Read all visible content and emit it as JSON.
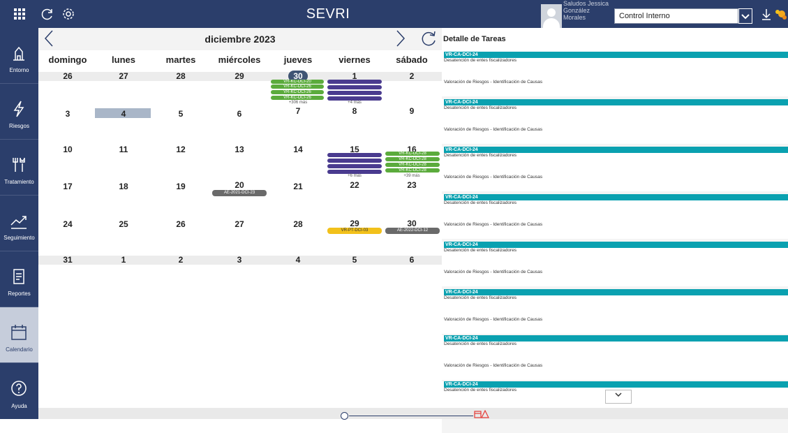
{
  "app": {
    "title": "SEVRI"
  },
  "user": {
    "greeting": "Saludos Jessica González Morales"
  },
  "selector": {
    "value": "Control Interno"
  },
  "sidebar": {
    "items": [
      {
        "label": "Entorno",
        "icon": "building-icon"
      },
      {
        "label": "Riesgos",
        "icon": "lightning-icon"
      },
      {
        "label": "Tratamiento",
        "icon": "tools-icon"
      },
      {
        "label": "Seguimiento",
        "icon": "trend-chart-icon"
      },
      {
        "label": "Reportes",
        "icon": "report-icon"
      },
      {
        "label": "Calendario",
        "icon": "calendar-icon"
      },
      {
        "label": "Ayuda",
        "icon": "help-icon"
      }
    ]
  },
  "calendar": {
    "month_label": "diciembre 2023",
    "weekdays": [
      "domingo",
      "lunes",
      "martes",
      "miércoles",
      "jueves",
      "viernes",
      "sábado"
    ],
    "weeks": [
      [
        "26",
        "27",
        "28",
        "29",
        "30",
        "1",
        "2"
      ],
      [
        "3",
        "4",
        "5",
        "6",
        "7",
        "8",
        "9"
      ],
      [
        "10",
        "11",
        "12",
        "13",
        "14",
        "15",
        "16"
      ],
      [
        "17",
        "18",
        "19",
        "20",
        "21",
        "22",
        "23"
      ],
      [
        "24",
        "25",
        "26",
        "27",
        "28",
        "29",
        "30"
      ],
      [
        "31",
        "1",
        "2",
        "3",
        "4",
        "5",
        "6"
      ]
    ],
    "events": {
      "thu30_pills": [
        "VR-KC-DCI-20",
        "VR-KC-DCI-26",
        "VR-KC-DCI-26",
        "VR-KC-DCI-26"
      ],
      "thu30_more": "+306 más",
      "fri1_more": "+4 más",
      "fri15_more": "+6 más",
      "sat16_pills": [
        "VR-KC-DCI-28",
        "VR-KC-DCI-28",
        "VR-KC-DCI-28",
        "VR-KC-DCI-28"
      ],
      "sat16_more": "+39 más",
      "wed20_pill": "AE-2021-DCI-23",
      "fri29_pill": "VR-PT-DCI-03",
      "sat30_pill": "AE-2022-DCI-12"
    }
  },
  "detail": {
    "title": "Detalle de Tareas",
    "tasks": [
      {
        "code": "VR-CA-DCI-24",
        "subtitle": "Desatención de entes fiscalizadores",
        "activity": "Valoración de Riesgos - Identificación de Causas"
      },
      {
        "code": "VR-CA-DCI-24",
        "subtitle": "Desatención de entes fiscalizadores",
        "activity": "Valoración de Riesgos - Identificación de Causas"
      },
      {
        "code": "VR-CA-DCI-24",
        "subtitle": "Desatención de entes fiscalizadores",
        "activity": "Valoración de Riesgos - Identificación de Causas"
      },
      {
        "code": "VR-CA-DCI-24",
        "subtitle": "Desatención de entes fiscalizadores",
        "activity": "Valoración de Riesgos - Identificación de Causas"
      },
      {
        "code": "VR-CA-DCI-24",
        "subtitle": "Desatención de entes fiscalizadores",
        "activity": "Valoración de Riesgos - Identificación de Causas"
      },
      {
        "code": "VR-CA-DCI-24",
        "subtitle": "Desatención de entes fiscalizadores",
        "activity": "Valoración de Riesgos - Identificación de Causas"
      },
      {
        "code": "VR-CA-DCI-24",
        "subtitle": "Desatención de entes fiscalizadores",
        "activity": "Valoración de Riesgos - Identificación de Causas"
      },
      {
        "code": "VR-CA-DCI-24",
        "subtitle": "Desatención de entes fiscalizadores",
        "activity": ""
      }
    ]
  },
  "colors": {
    "nav": "#2b3e6b",
    "accent_teal": "#0aa1b0",
    "green": "#5bab3c",
    "purple": "#4a3b8f",
    "warning": "#e53935"
  }
}
